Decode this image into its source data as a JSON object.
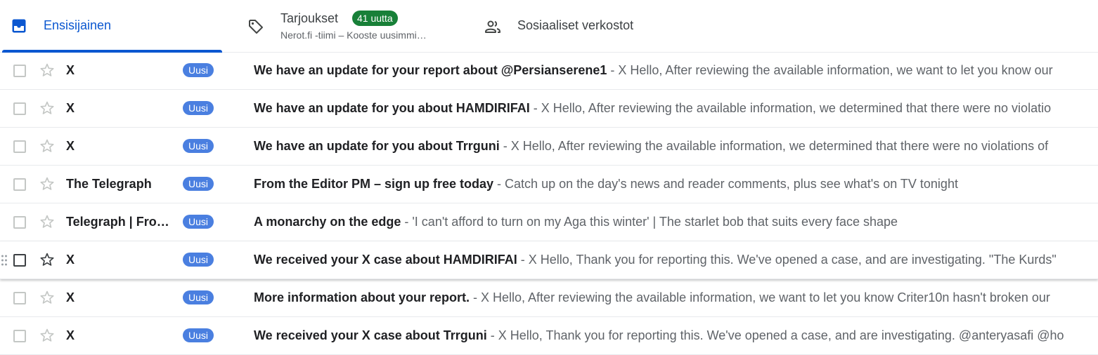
{
  "tabs": {
    "primary": {
      "label": "Ensisijainen",
      "icon": "inbox-icon",
      "accent": "#0b57d0"
    },
    "promotions": {
      "label": "Tarjoukset",
      "badge": "41 uutta",
      "subtitle": "Nerot.fi -tiimi – Kooste uusimmi…",
      "icon": "tag-icon",
      "badge_color": "#188038"
    },
    "social": {
      "label": "Sosiaaliset verkostot",
      "icon": "people-icon"
    }
  },
  "emails": [
    {
      "sender": "X",
      "tag": "Uusi",
      "subject": "We have an update for your report about @Persianserene1",
      "snippet": " - X Hello, After reviewing the available information, we want to let you know our"
    },
    {
      "sender": "X",
      "tag": "Uusi",
      "subject": "We have an update for you about HAMDIRIFAI",
      "snippet": " - X Hello, After reviewing the available information, we determined that there were no violatio"
    },
    {
      "sender": "X",
      "tag": "Uusi",
      "subject": "We have an update for you about Trrguni",
      "snippet": " - X Hello, After reviewing the available information, we determined that there were no violations of"
    },
    {
      "sender": "The Telegraph",
      "tag": "Uusi",
      "subject": "From the Editor PM – sign up free today",
      "snippet": " - Catch up on the day's news and reader comments, plus see what's on TV tonight"
    },
    {
      "sender": "Telegraph | Fro…",
      "tag": "Uusi",
      "subject": "A monarchy on the edge",
      "snippet": " - 'I can't afford to turn on my Aga this winter' | The starlet bob that suits every face shape"
    },
    {
      "sender": "X",
      "tag": "Uusi",
      "subject": "We received your X case about HAMDIRIFAI",
      "snippet": " - X Hello, Thank you for reporting this. We've opened a case, and are investigating. \"The Kurds\""
    },
    {
      "sender": "X",
      "tag": "Uusi",
      "subject": "More information about your report.",
      "snippet": " - X Hello, After reviewing the available information, we want to let you know Criter10n hasn't broken our"
    },
    {
      "sender": "X",
      "tag": "Uusi",
      "subject": "We received your X case about Trrguni",
      "snippet": " - X Hello, Thank you for reporting this. We've opened a case, and are investigating. @anteryasafi @ho"
    }
  ],
  "colors": {
    "new_tag": "#4a7fe0"
  }
}
